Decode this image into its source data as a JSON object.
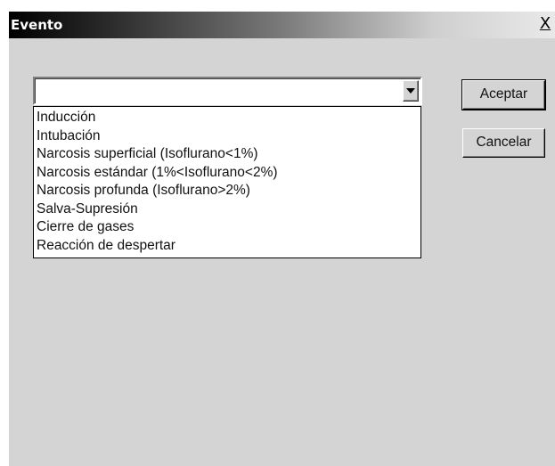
{
  "window": {
    "title": "Evento",
    "close_label": "X"
  },
  "combo": {
    "value": "",
    "items": [
      "Inducción",
      "Intubación",
      "Narcosis superficial (Isoflurano<1%)",
      "Narcosis estándar (1%<Isoflurano<2%)",
      "Narcosis profunda (Isoflurano>2%)",
      "Salva-Supresión",
      "Cierre de gases",
      "Reacción de despertar"
    ]
  },
  "buttons": {
    "accept_label": "Aceptar",
    "cancel_label": "Cancelar"
  },
  "colors": {
    "dialog_face": "#d4d4d4",
    "title_text": "#ffffff"
  }
}
